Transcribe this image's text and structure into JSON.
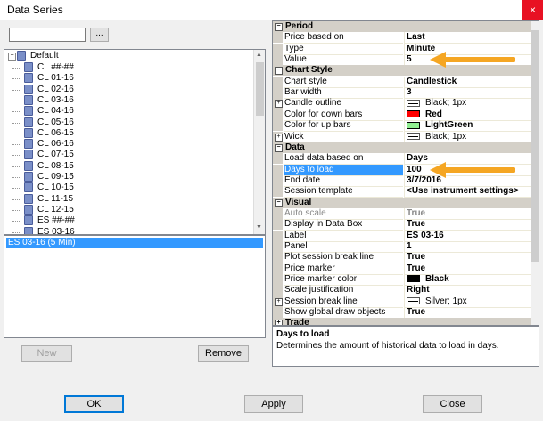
{
  "window": {
    "title": "Data Series",
    "close_glyph": "×"
  },
  "search": {
    "value": "",
    "browse_label": "..."
  },
  "tree": {
    "root_label": "Default",
    "items": [
      "CL ##-##",
      "CL 01-16",
      "CL 02-16",
      "CL 03-16",
      "CL 04-16",
      "CL 05-16",
      "CL 06-15",
      "CL 06-16",
      "CL 07-15",
      "CL 08-15",
      "CL 09-15",
      "CL 10-15",
      "CL 11-15",
      "CL 12-15",
      "ES ##-##",
      "ES 03-16"
    ]
  },
  "series_list": {
    "items": [
      "ES 03-16 (5 Min)"
    ]
  },
  "buttons": {
    "new": "New",
    "remove": "Remove",
    "ok": "OK",
    "apply": "Apply",
    "close": "Close"
  },
  "properties": {
    "period": {
      "label": "Period",
      "rows": [
        {
          "name": "Price based on",
          "value": "Last"
        },
        {
          "name": "Type",
          "value": "Minute"
        },
        {
          "name": "Value",
          "value": "5"
        }
      ]
    },
    "chart_style": {
      "label": "Chart Style",
      "rows": [
        {
          "name": "Chart style",
          "value": "Candlestick"
        },
        {
          "name": "Bar width",
          "value": "3"
        },
        {
          "name": "Candle outline",
          "value": "Black; 1px"
        },
        {
          "name": "Color for down bars",
          "value": "Red"
        },
        {
          "name": "Color for up bars",
          "value": "LightGreen"
        },
        {
          "name": "Wick",
          "value": "Black; 1px"
        }
      ]
    },
    "data": {
      "label": "Data",
      "rows": [
        {
          "name": "Load data based on",
          "value": "Days"
        },
        {
          "name": "Days to load",
          "value": "100"
        },
        {
          "name": "End date",
          "value": "3/7/2016"
        },
        {
          "name": "Session template",
          "value": "<Use instrument settings>"
        }
      ]
    },
    "visual": {
      "label": "Visual",
      "rows": [
        {
          "name": "Auto scale",
          "value": "True"
        },
        {
          "name": "Display in Data Box",
          "value": "True"
        },
        {
          "name": "Label",
          "value": "ES 03-16"
        },
        {
          "name": "Panel",
          "value": "1"
        },
        {
          "name": "Plot session break line",
          "value": "True"
        },
        {
          "name": "Price marker",
          "value": "True"
        },
        {
          "name": "Price marker color",
          "value": "Black"
        },
        {
          "name": "Scale justification",
          "value": "Right"
        },
        {
          "name": "Session break line",
          "value": "Silver; 1px"
        },
        {
          "name": "Show global draw objects",
          "value": "True"
        }
      ]
    },
    "next_category": {
      "label": "Trade"
    }
  },
  "description": {
    "title": "Days to load",
    "text": "Determines the amount of historical data to load in days."
  },
  "colors": {
    "selection": "#3399ff",
    "down_bars": "#ff0000",
    "up_bars": "#90ee90",
    "price_marker": "#000000",
    "annotation_arrow": "#f5a623"
  }
}
